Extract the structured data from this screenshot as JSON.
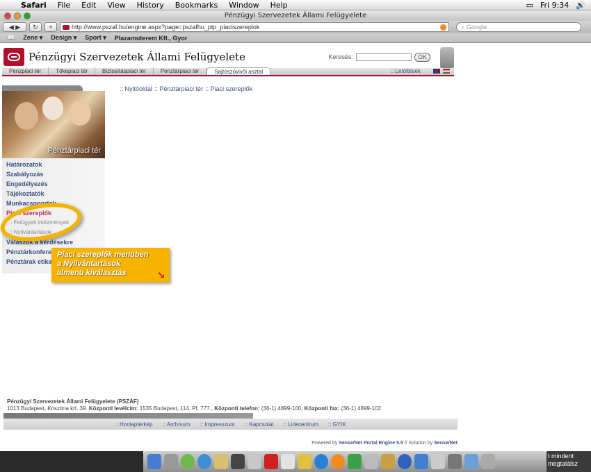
{
  "menubar": {
    "app": "Safari",
    "items": [
      "File",
      "Edit",
      "View",
      "History",
      "Bookmarks",
      "Window",
      "Help"
    ],
    "clock": "Fri 9:34"
  },
  "window": {
    "title": "Pénzügyi Szervezetek Állami Felügyelete"
  },
  "toolbar": {
    "back": "◀ ▶",
    "reload": "↻",
    "add": "+",
    "url": "http://www.pszaf.hu/engine.aspx?page=pszafhu_ptp_piaciszereplok",
    "search_placeholder": "Google"
  },
  "bookmarks": {
    "items": [
      "Zene ▾",
      "Design ▾",
      "Sport ▾",
      "Plazamuterem Kft., Gyor"
    ]
  },
  "site": {
    "title": "Pénzügyi Szervezetek Állami Felügyelete",
    "search_label": "Keresés:",
    "ok_label": "OK",
    "nav_tabs": [
      "Pénzpiaci tér",
      "Tőkepiaci tér",
      "Biztosításpiaci tér",
      "Pénztárpiaci tér",
      "Sajtószóvivői asztal"
    ],
    "downloads": ":: Letöltések"
  },
  "sidebar": {
    "photo_caption": "Pénztárpiaci tér",
    "items": [
      {
        "label": "Határozatok"
      },
      {
        "label": "Szabályozás"
      },
      {
        "label": "Engedélyezés"
      },
      {
        "label": "Tájékoztatók"
      },
      {
        "label": "Munkacsoportok"
      },
      {
        "label": "Piaci szereplők"
      },
      {
        "label": ":: Felügyelt intézmények"
      },
      {
        "label": ":: Nyilvántartások"
      },
      {
        "label": "Válaszok a kérdésekre"
      },
      {
        "label": "Pénztárkonferencia"
      },
      {
        "label": "Pénztárak etikai kódexe"
      }
    ]
  },
  "breadcrumb": {
    "home": ":: Nyitóoldal",
    "level1": ":: Pénztárpiaci tér",
    "level2": ":: Piaci szereplők"
  },
  "callout": {
    "line1": "Piaci szereplők menüben",
    "line2": "a Nyilvántartások",
    "line3": "almenü kiválasztás"
  },
  "footer": {
    "org": "Pénzügyi Szervezetek Állami Felügyelete (PSZÁF)",
    "address": "1013 Budapest, Krisztina krt. 39.",
    "mail_label": "Központi levélcím:",
    "mail_value": "1535 Budapest, 114. Pf. 777.,",
    "phone_label": "Központi telefon:",
    "phone_value": "(36-1) 4899-100,",
    "fax_label": "Központi fax:",
    "fax_value": "(36-1) 4899-102",
    "links": [
      ":: Honlaptérkép",
      ":: Archívum",
      ":: Impresszum",
      ":: Kapcsolat",
      ":: Linkcentrum",
      ":: GYIK"
    ],
    "powered_prefix": "Powered by",
    "powered_engine": "Sense/Net Portal Engine 5.5",
    "powered_mid": "// Solution by",
    "powered_sol": "Sense/Net"
  },
  "desktop": {
    "text1": "t mindent",
    "text2": "megtalálsz"
  },
  "colors": {
    "brand_red": "#b0102a",
    "link_blue": "#3a4f80",
    "callout_yellow": "#f6b400",
    "active_menu": "#c0304a"
  }
}
